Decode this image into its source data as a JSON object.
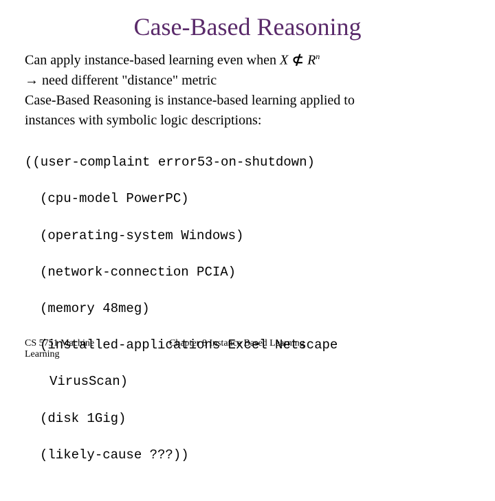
{
  "title": "Case-Based Reasoning",
  "line1_a": "Can apply instance-based learning even when ",
  "line1_x": "X",
  "line1_neq": " ⊄ ",
  "line1_r": "R",
  "line1_n": "n",
  "line2_arrow": "→",
  "line2_text": " need different \"distance\" metric",
  "line3": "Case-Based Reasoning is instance-based learning applied to",
  "line3b": "instances with symbolic logic descriptions:",
  "code": {
    "l1": "((user-complaint error53-on-shutdown)",
    "l2": "(cpu-model PowerPC)",
    "l3": "(operating-system Windows)",
    "l4": "(network-connection PCIA)",
    "l5": "(memory 48meg)",
    "l6": "(installed-applications Excel Netscape",
    "l7": "VirusScan)",
    "l8": "(disk 1Gig)",
    "l9": "(likely-cause ???))"
  },
  "footer": {
    "left1": "CS 5751 Machine",
    "left2": "Learning",
    "center": "Chapter 8  Instance Based Learning"
  }
}
